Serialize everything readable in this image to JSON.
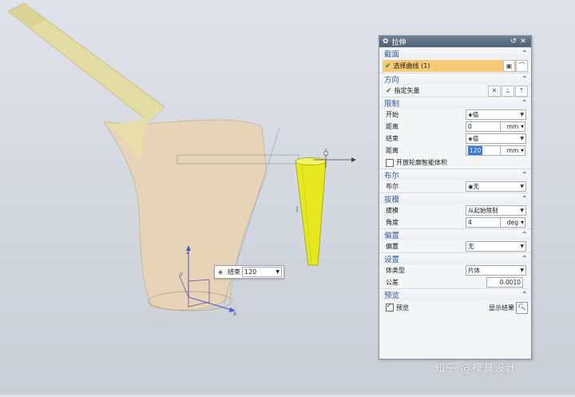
{
  "viewport": {
    "axes": {
      "z": "Z",
      "y": "Y",
      "x": "X"
    },
    "dynamic_input": {
      "label": "结束",
      "value": "120"
    }
  },
  "dialog": {
    "title": "拉伸",
    "sections": {
      "section": {
        "title": "截面",
        "curve_label": "选择曲线 (1)"
      },
      "direction": {
        "title": "方向",
        "vector_label": "指定矢量"
      },
      "limits": {
        "title": "限制",
        "start_label": "开始",
        "start_value": "值",
        "start_dist_label": "距离",
        "start_dist_value": "0",
        "start_unit": "mm",
        "end_label": "结束",
        "end_value": "值",
        "end_dist_label": "距离",
        "end_dist_value": "120",
        "end_unit": "mm",
        "open_profile_label": "开放轮廓智能体积"
      },
      "boolean": {
        "title": "布尔",
        "label": "布尔",
        "value": "无"
      },
      "draft": {
        "title": "拔模",
        "label": "拔模",
        "value": "从起始限制",
        "angle_label": "角度",
        "angle_value": "4",
        "angle_unit": "deg"
      },
      "offset": {
        "title": "偏置",
        "label": "偏置",
        "value": "无"
      },
      "settings": {
        "title": "设置",
        "body_type_label": "体类型",
        "body_type_value": "片体",
        "tolerance_label": "公差",
        "tolerance_value": "0.0010"
      },
      "preview": {
        "title": "预览",
        "preview_label": "预览",
        "show_result_label": "显示结果"
      }
    }
  },
  "watermark": "知乎 @模具设计"
}
